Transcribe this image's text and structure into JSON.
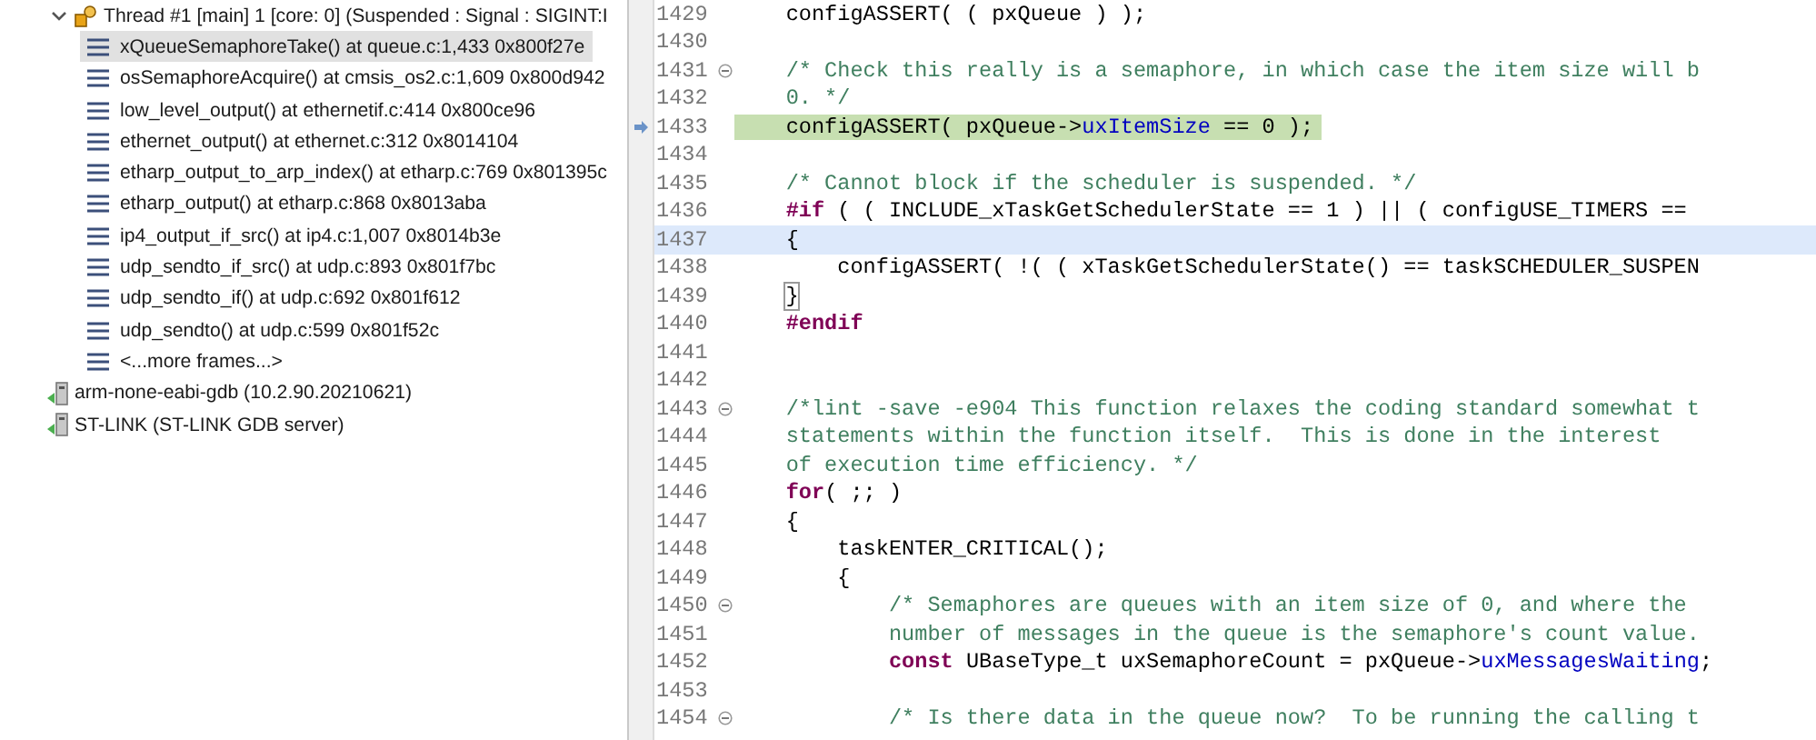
{
  "debug_tree": {
    "thread": {
      "label": "Thread #1 [main] 1 [core: 0] (Suspended : Signal : SIGINT:I",
      "expanded": true
    },
    "frames": [
      {
        "label": "xQueueSemaphoreTake() at queue.c:1,433 0x800f27e",
        "selected": true
      },
      {
        "label": "osSemaphoreAcquire() at cmsis_os2.c:1,609 0x800d942",
        "selected": false
      },
      {
        "label": "low_level_output() at ethernetif.c:414 0x800ce96",
        "selected": false
      },
      {
        "label": "ethernet_output() at ethernet.c:312 0x8014104",
        "selected": false
      },
      {
        "label": "etharp_output_to_arp_index() at etharp.c:769 0x801395c",
        "selected": false
      },
      {
        "label": "etharp_output() at etharp.c:868 0x8013aba",
        "selected": false
      },
      {
        "label": "ip4_output_if_src() at ip4.c:1,007 0x8014b3e",
        "selected": false
      },
      {
        "label": "udp_sendto_if_src() at udp.c:893 0x801f7bc",
        "selected": false
      },
      {
        "label": "udp_sendto_if() at udp.c:692 0x801f612",
        "selected": false
      },
      {
        "label": "udp_sendto() at udp.c:599 0x801f52c",
        "selected": false
      },
      {
        "label": "<...more frames...>",
        "selected": false
      }
    ],
    "launches": [
      {
        "label": "arm-none-eabi-gdb (10.2.90.20210621)"
      },
      {
        "label": "ST-LINK (ST-LINK GDB server)"
      }
    ]
  },
  "editor": {
    "lines": [
      {
        "number": "1429",
        "fold": false,
        "executing": false,
        "current": false,
        "tokens": [
          {
            "kind": "code",
            "text": "    configASSERT( ( pxQueue ) );"
          }
        ]
      },
      {
        "number": "1430",
        "fold": false,
        "executing": false,
        "current": false
      },
      {
        "number": "1431",
        "fold": true,
        "executing": false,
        "current": false,
        "tokens": [
          {
            "kind": "comment",
            "text": "    /* Check this really is a semaphore, in which case the item size will b"
          }
        ]
      },
      {
        "number": "1432",
        "fold": false,
        "executing": false,
        "current": false,
        "tokens": [
          {
            "kind": "comment",
            "text": "    0. */"
          }
        ]
      },
      {
        "number": "1433",
        "fold": false,
        "executing": true,
        "current": false,
        "tokens": [
          {
            "kind": "code",
            "text": "    configASSERT( pxQueue->"
          },
          {
            "kind": "field",
            "text": "uxItemSize"
          },
          {
            "kind": "code",
            "text": " == 0 );"
          }
        ]
      },
      {
        "number": "1434",
        "fold": false,
        "executing": false,
        "current": false
      },
      {
        "number": "1435",
        "fold": false,
        "executing": false,
        "current": false,
        "tokens": [
          {
            "kind": "comment",
            "text": "    /* Cannot block if the scheduler is suspended. */"
          }
        ]
      },
      {
        "number": "1436",
        "fold": false,
        "executing": false,
        "current": false,
        "tokens": [
          {
            "kind": "keyword",
            "text": "    #if"
          },
          {
            "kind": "code",
            "text": " ( ( INCLUDE_xTaskGetSchedulerState == 1 ) || ( configUSE_TIMERS =="
          }
        ]
      },
      {
        "number": "1437",
        "fold": false,
        "executing": false,
        "current": true,
        "tokens": [
          {
            "kind": "code",
            "text": "    {"
          }
        ]
      },
      {
        "number": "1438",
        "fold": false,
        "executing": false,
        "current": false,
        "tokens": [
          {
            "kind": "code",
            "text": "        configASSERT( !( ( xTaskGetSchedulerState() == taskSCHEDULER_SUSPEN"
          }
        ]
      },
      {
        "number": "1439",
        "fold": false,
        "executing": false,
        "current": false,
        "tokens": [
          {
            "kind": "bracket",
            "text": "}"
          }
        ]
      },
      {
        "number": "1440",
        "fold": false,
        "executing": false,
        "current": false,
        "tokens": [
          {
            "kind": "keyword",
            "text": "    #endif"
          }
        ]
      },
      {
        "number": "1441",
        "fold": false,
        "executing": false,
        "current": false
      },
      {
        "number": "1442",
        "fold": false,
        "executing": false,
        "current": false
      },
      {
        "number": "1443",
        "fold": true,
        "executing": false,
        "current": false,
        "tokens": [
          {
            "kind": "comment",
            "text": "    /*lint -save -e904 This function relaxes the coding standard somewhat t"
          }
        ]
      },
      {
        "number": "1444",
        "fold": false,
        "executing": false,
        "current": false,
        "tokens": [
          {
            "kind": "comment",
            "text": "    statements within the function itself.  This is done in the interest"
          }
        ]
      },
      {
        "number": "1445",
        "fold": false,
        "executing": false,
        "current": false,
        "tokens": [
          {
            "kind": "comment",
            "text": "    of execution time efficiency. */"
          }
        ]
      },
      {
        "number": "1446",
        "fold": false,
        "executing": false,
        "current": false,
        "tokens": [
          {
            "kind": "keyword",
            "text": "    for"
          },
          {
            "kind": "code",
            "text": "( ;; )"
          }
        ]
      },
      {
        "number": "1447",
        "fold": false,
        "executing": false,
        "current": false,
        "tokens": [
          {
            "kind": "code",
            "text": "    {"
          }
        ]
      },
      {
        "number": "1448",
        "fold": false,
        "executing": false,
        "current": false,
        "tokens": [
          {
            "kind": "code",
            "text": "        taskENTER_CRITICAL();"
          }
        ]
      },
      {
        "number": "1449",
        "fold": false,
        "executing": false,
        "current": false,
        "tokens": [
          {
            "kind": "code",
            "text": "        {"
          }
        ]
      },
      {
        "number": "1450",
        "fold": true,
        "executing": false,
        "current": false,
        "tokens": [
          {
            "kind": "comment",
            "text": "            /* Semaphores are queues with an item size of 0, and where the"
          }
        ]
      },
      {
        "number": "1451",
        "fold": false,
        "executing": false,
        "current": false,
        "tokens": [
          {
            "kind": "comment",
            "text": "            number of messages in the queue is the semaphore's count value."
          }
        ]
      },
      {
        "number": "1452",
        "fold": false,
        "executing": false,
        "current": false,
        "tokens": [
          {
            "kind": "keyword",
            "text": "            const"
          },
          {
            "kind": "code",
            "text": " UBaseType_t uxSemaphoreCount = pxQueue->"
          },
          {
            "kind": "field",
            "text": "uxMessagesWaiting"
          },
          {
            "kind": "code",
            "text": ";"
          }
        ]
      },
      {
        "number": "1453",
        "fold": false,
        "executing": false,
        "current": false
      },
      {
        "number": "1454",
        "fold": true,
        "executing": false,
        "current": false,
        "tokens": [
          {
            "kind": "comment",
            "text": "            /* Is there data in the queue now?  To be running the calling t"
          }
        ]
      }
    ]
  }
}
